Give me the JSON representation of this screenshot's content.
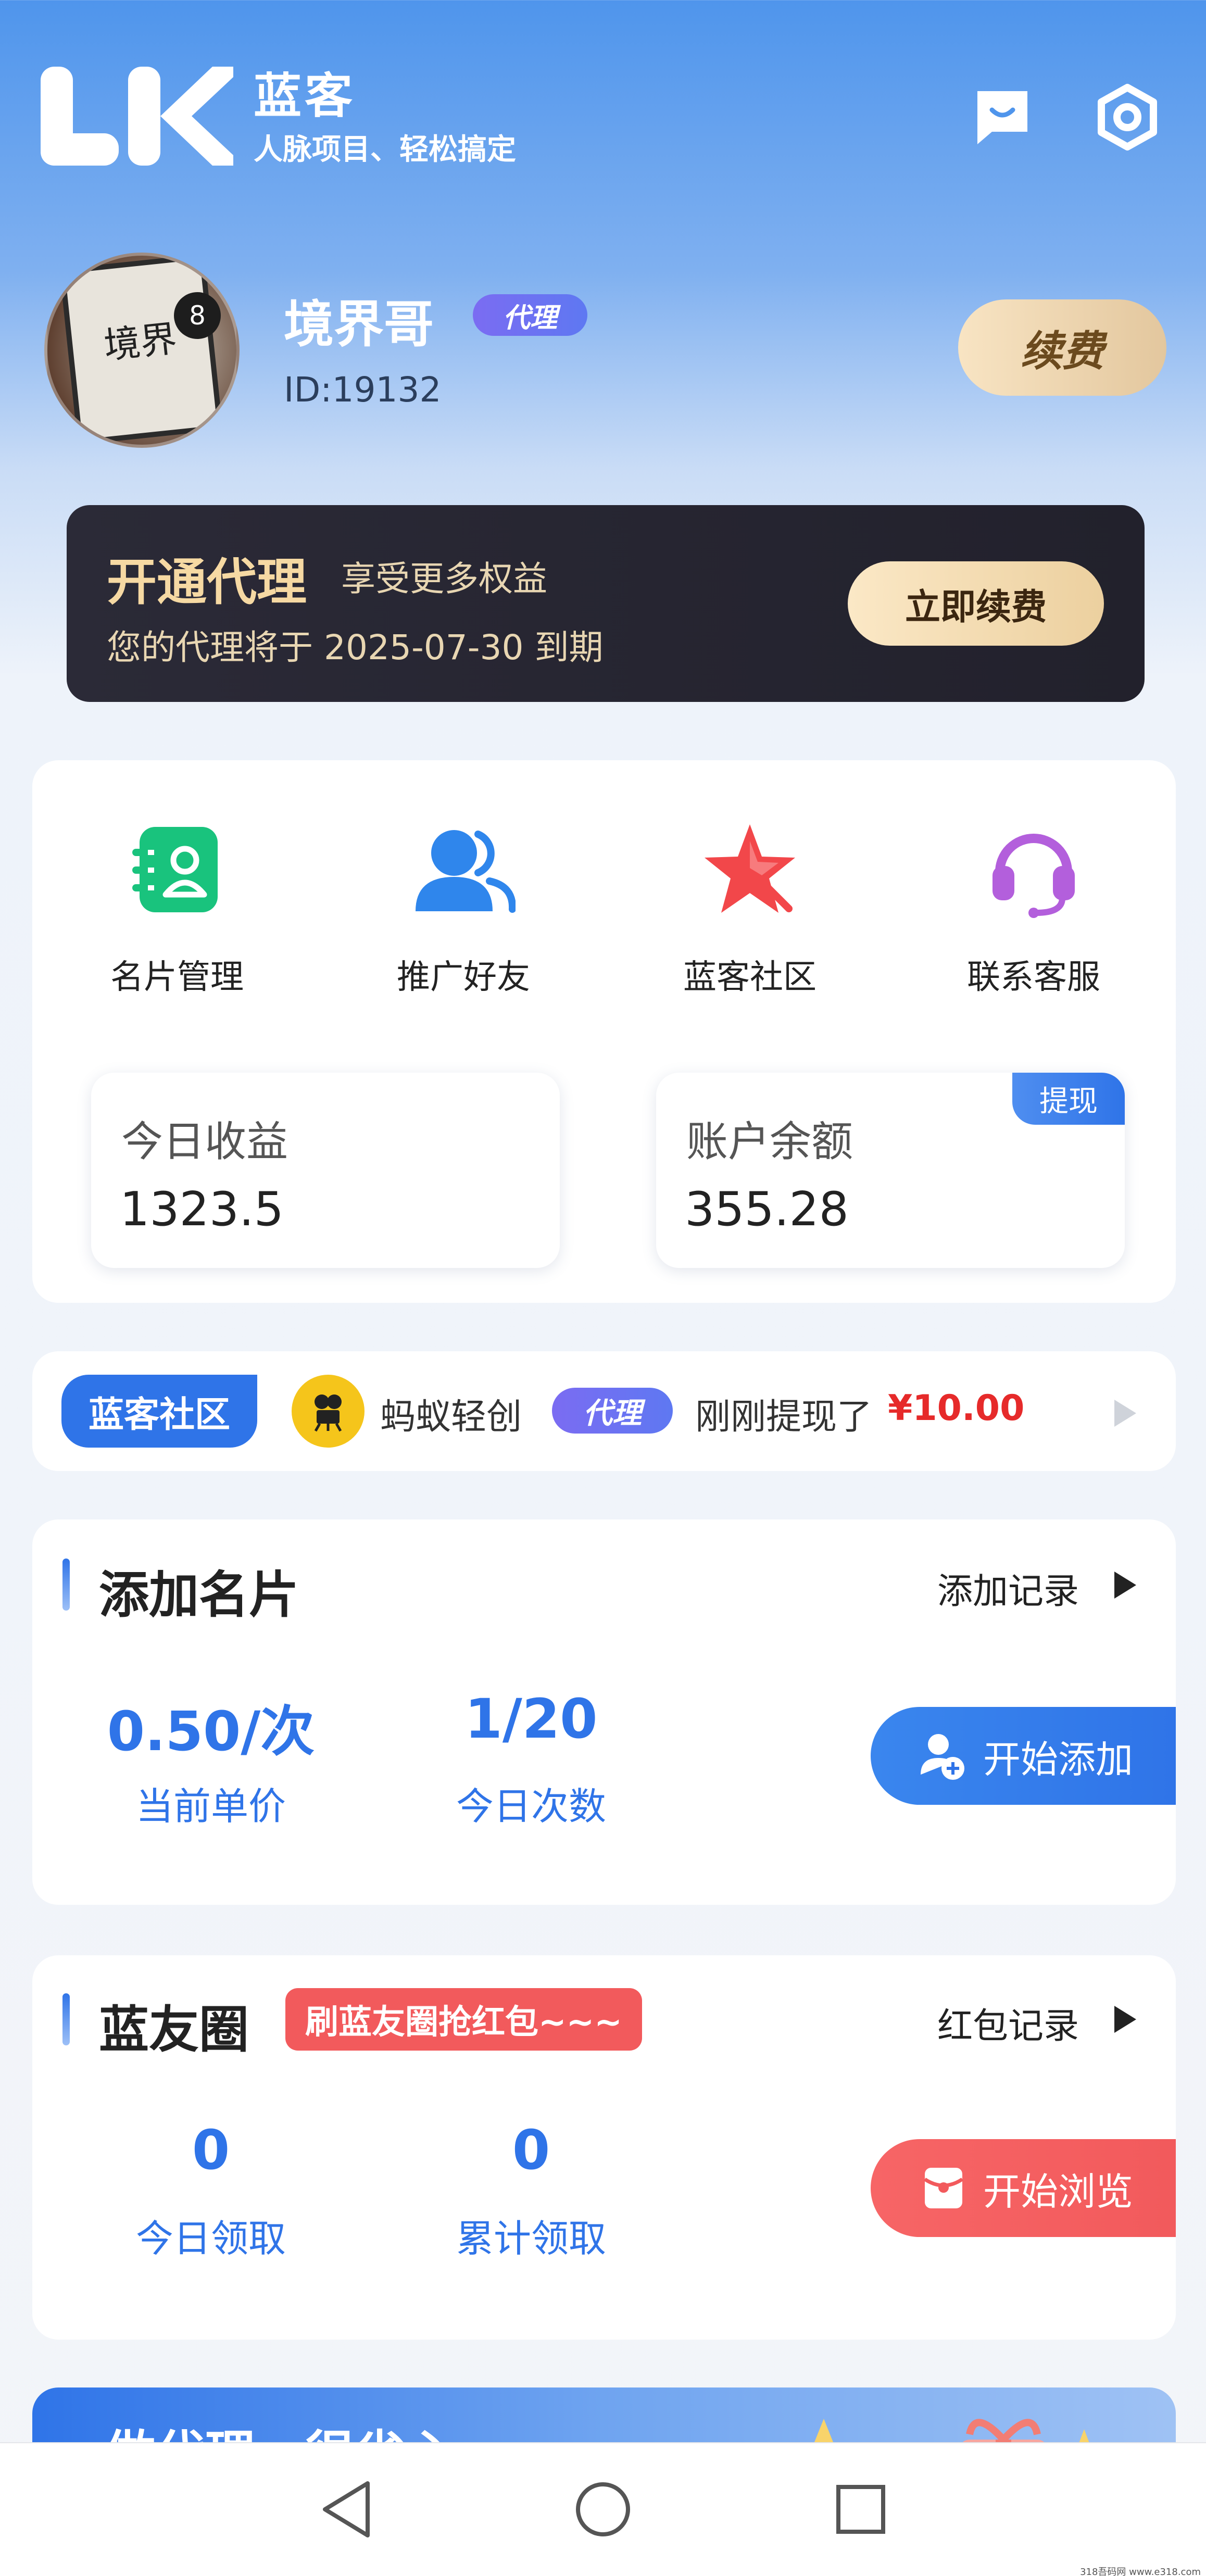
{
  "header": {
    "brand_name": "蓝客",
    "slogan": "人脉项目、轻松搞定",
    "logo_text": "LK"
  },
  "profile": {
    "name": "境界哥",
    "role_badge": "代理",
    "id_text": "ID:19132",
    "renew_label": "续费",
    "avatar_text": "境界"
  },
  "agent_banner": {
    "title": "开通代理",
    "subtitle": "享受更多权益",
    "expire_text": "您的代理将于 2025-07-30 到期",
    "button_label": "立即续费"
  },
  "quick_menu": {
    "items": [
      {
        "label": "名片管理",
        "icon": "contact-card-icon",
        "color": "#19c37d"
      },
      {
        "label": "推广好友",
        "icon": "users-icon",
        "color": "#2f86ec"
      },
      {
        "label": "蓝客社区",
        "icon": "star-icon",
        "color": "#f2474a"
      },
      {
        "label": "联系客服",
        "icon": "headset-icon",
        "color": "#b35fdc"
      }
    ],
    "today_income": {
      "label": "今日收益",
      "value": "1323.5"
    },
    "balance": {
      "label": "账户余额",
      "value": "355.28",
      "tag": "提现"
    }
  },
  "ticker": {
    "tag": "蓝客社区",
    "user": "蚂蚁轻创",
    "badge": "代理",
    "text": "刚刚提现了",
    "amount": "¥10.00"
  },
  "add_card": {
    "title": "添加名片",
    "link": "添加记录",
    "price_value": "0.50/次",
    "price_label": "当前单价",
    "count_value": "1/20",
    "count_label": "今日次数",
    "button_label": "开始添加"
  },
  "circle": {
    "title": "蓝友圈",
    "promo_tag": "刷蓝友圈抢红包~~~",
    "link": "红包记录",
    "today_value": "0",
    "today_label": "今日领取",
    "total_value": "0",
    "total_label": "累计领取",
    "button_label": "开始浏览"
  },
  "promo_banner": {
    "text": "做代理，很省心"
  },
  "colors": {
    "accent": "#2f74e8",
    "red": "#f25a5c",
    "gold": "#e3c79e"
  },
  "watermark": "318吾码网 www.e318.com"
}
